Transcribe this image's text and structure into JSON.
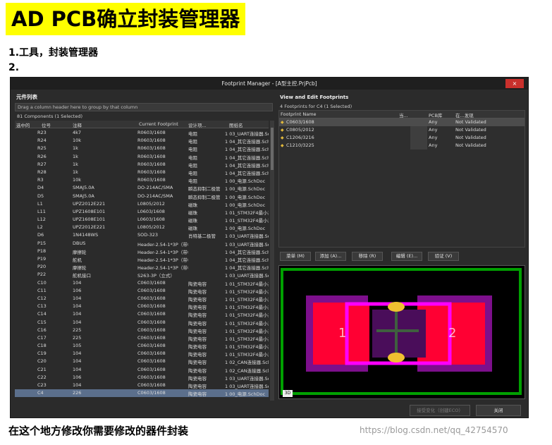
{
  "doc": {
    "title": "AD PCB确立封装管理器",
    "step1": "1.工具，封装管理器",
    "step2": "2.",
    "caption": "在这个地方修改你需要修改的器件封装",
    "watermark": "https://blog.csdn.net/qq_42754570"
  },
  "window": {
    "title": "Footprint Manager - [A型主控.PrjPcb]",
    "close_label": "×"
  },
  "left": {
    "panel_title": "元件列表",
    "group_hint": "Drag a column header here to group by that column",
    "components_count": "81 Components (1 Selected)",
    "columns": [
      "选中的",
      "位号",
      "注释",
      "Current Footprint",
      "设计项...",
      "图纸名"
    ],
    "rows": [
      [
        "R23",
        "4k7",
        "R0603/1608",
        "电阻",
        "1 03_UART连接器.Sch"
      ],
      [
        "R24",
        "10k",
        "R0603/1608",
        "电阻",
        "1 04_其它连接器.Sch"
      ],
      [
        "R25",
        "1k",
        "R0603/1608",
        "电阻",
        "1 04_其它连接器.Sch"
      ],
      [
        "R26",
        "1k",
        "R0603/1608",
        "电阻",
        "1 04_其它连接器.Sch"
      ],
      [
        "R27",
        "1k",
        "R0603/1608",
        "电阻",
        "1 04_其它连接器.Sch"
      ],
      [
        "R28",
        "1k",
        "R0603/1608",
        "电阻",
        "1 04_其它连接器.Sch"
      ],
      [
        "R3",
        "10k",
        "R0603/1608",
        "电阻",
        "1 00_电源.SchDoc"
      ],
      [
        "D4",
        "SMAJ5.0A",
        "DO-214AC/SMA",
        "瞬态抑制二极管",
        "1 00_电源.SchDoc"
      ],
      [
        "D5",
        "SMAJ5.0A",
        "DO-214AC/SMA",
        "瞬态抑制二极管",
        "1 00_电源.SchDoc"
      ],
      [
        "L1",
        "UPZ2012E221",
        "L0805/2012",
        "磁珠",
        "1 00_电源.SchDoc"
      ],
      [
        "L11",
        "UPZ1608E101",
        "L0603/1608",
        "磁珠",
        "1 01_STM32F4最小系统"
      ],
      [
        "L12",
        "UPZ1608E101",
        "L0603/1608",
        "磁珠",
        "1 01_STM32F4最小系统"
      ],
      [
        "L2",
        "UPZ2012E221",
        "L0805/2012",
        "磁珠",
        "1 00_电源.SchDoc"
      ],
      [
        "D6",
        "1N4148WS",
        "SOD-323",
        "肖特基二极管",
        "1 03_UART连接器.Sch"
      ],
      [
        "P15",
        "DBUS",
        "Header-2.54-1*3P（带框机接口",
        "",
        "1 03_UART连接器.Sch"
      ],
      [
        "P18",
        "摩擦轮",
        "Header-2.54-1*3P（带框机接口",
        "",
        "1 04_其它连接器.Sch"
      ],
      [
        "P19",
        "舵机",
        "Header-2.54-1*3P（带框机接口",
        "",
        "1 04_其它连接器.Sch"
      ],
      [
        "P20",
        "摩擦轮",
        "Header-2.54-1*3P（带框机接口",
        "",
        "1 04_其它连接器.Sch"
      ],
      [
        "P22",
        "舵机接口",
        "S263-3P（立式）",
        "",
        "1 03_UART连接器.Sch"
      ],
      [
        "C10",
        "104",
        "C0603/1608",
        "陶瓷电容",
        "1 01_STM32F4最小系统"
      ],
      [
        "C11",
        "106",
        "C0603/1608",
        "陶瓷电容",
        "1 01_STM32F4最小系统"
      ],
      [
        "C12",
        "104",
        "C0603/1608",
        "陶瓷电容",
        "1 01_STM32F4最小系统"
      ],
      [
        "C13",
        "104",
        "C0603/1608",
        "陶瓷电容",
        "1 01_STM32F4最小系统"
      ],
      [
        "C14",
        "104",
        "C0603/1608",
        "陶瓷电容",
        "1 01_STM32F4最小系统"
      ],
      [
        "C15",
        "104",
        "C0603/1608",
        "陶瓷电容",
        "1 01_STM32F4最小系统"
      ],
      [
        "C16",
        "225",
        "C0603/1608",
        "陶瓷电容",
        "1 01_STM32F4最小系统"
      ],
      [
        "C17",
        "225",
        "C0603/1608",
        "陶瓷电容",
        "1 01_STM32F4最小系统"
      ],
      [
        "C18",
        "105",
        "C0603/1608",
        "陶瓷电容",
        "1 01_STM32F4最小系统"
      ],
      [
        "C19",
        "104",
        "C0603/1608",
        "陶瓷电容",
        "1 01_STM32F4最小系统"
      ],
      [
        "C20",
        "104",
        "C0603/1608",
        "陶瓷电容",
        "1 02_CAN连接器.Sch"
      ],
      [
        "C21",
        "104",
        "C0603/1608",
        "陶瓷电容",
        "1 02_CAN连接器.Sch"
      ],
      [
        "C22",
        "106",
        "C0603/1608",
        "陶瓷电容",
        "1 03_UART连接器.Sch"
      ],
      [
        "C23",
        "104",
        "C0603/1608",
        "陶瓷电容",
        "1 03_UART连接器.Sch"
      ],
      [
        "C4",
        "226",
        "C0603/1608",
        "陶瓷电容",
        "1 00_电源.SchDoc"
      ]
    ],
    "selected_row": 33
  },
  "right": {
    "panel_title": "View and Edit Footprints",
    "fp_count": "4 Footprints for C4 (1 Selected)",
    "columns": [
      "Footprint Name",
      "当...",
      "PCB库",
      "在...发现"
    ],
    "rows": [
      [
        "C0603/1608",
        "Any",
        "Not Validated"
      ],
      [
        "C0805/2012",
        "Any",
        "Not Validated"
      ],
      [
        "C1206/3216",
        "Any",
        "Not Validated"
      ],
      [
        "C1210/3225",
        "Any",
        "Not Validated"
      ]
    ],
    "buttons": [
      "菜单 (M)",
      "添加 (A)...",
      "移除 (R)",
      "编辑 (E)...",
      "验证 (V)"
    ],
    "preview": {
      "pad_left": "1",
      "pad_right": "2",
      "badge": "3D"
    }
  },
  "footer": {
    "accept_label": "接受变化（创建ECO）",
    "close_label": "关闭"
  },
  "colors": {
    "highlight": "#ffff00",
    "selected_row": "#5b6f8c",
    "pad": "#ff0033",
    "overlay": "#ff00ff",
    "board_outline": "#00a000"
  }
}
